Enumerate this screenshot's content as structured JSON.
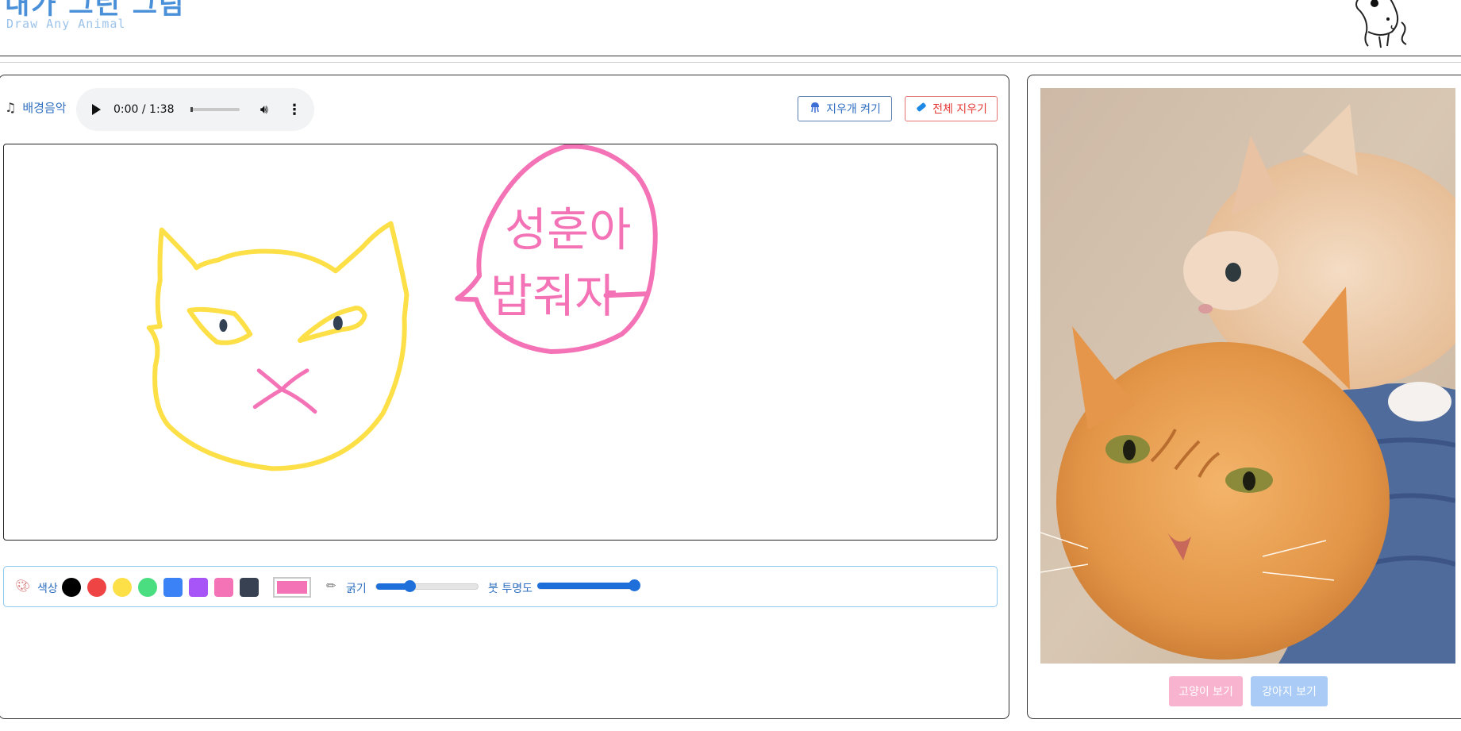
{
  "header": {
    "title": "내가 그린 그림",
    "subtitle": "Draw Any Animal",
    "mascot_icon": "puppy-mascot-icon"
  },
  "audio": {
    "label": "배경음악",
    "time": "0:00 / 1:38",
    "progress": 0
  },
  "tools": {
    "eraser_label": "지우개 켜기",
    "clear_label": "전체 지우기"
  },
  "canvas": {
    "speech_text_line1": "성훈아",
    "speech_text_line2": "밥줘자"
  },
  "toolbar": {
    "color_label": "색상",
    "colors": [
      "#000000",
      "#ef4444",
      "#fde047",
      "#4ade80",
      "#3b82f6",
      "#a855f7",
      "#f472b6",
      "#374151"
    ],
    "current_color": "#f472b6",
    "thickness_label": "굵기",
    "thickness_value": 0.33,
    "opacity_label": "붓 투명도",
    "opacity_value": 1.0
  },
  "reference": {
    "subject": "two orange tabby kittens",
    "show_cat_label": "고양이 보기",
    "show_dog_label": "강아지 보기"
  }
}
